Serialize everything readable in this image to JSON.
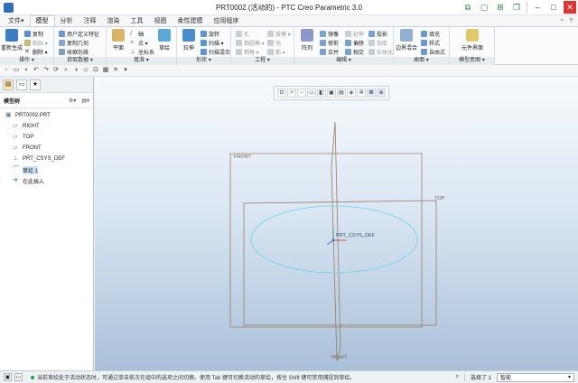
{
  "window": {
    "title": "PRT0002 (活动的) - PTC Creo Parametric 3.0",
    "accent": "#2f6fb5"
  },
  "tabs": [
    {
      "label": "文件",
      "suffix": "▾"
    },
    {
      "label": "模型",
      "active": true
    },
    {
      "label": "分析"
    },
    {
      "label": "注释"
    },
    {
      "label": "渲染"
    },
    {
      "label": "工具"
    },
    {
      "label": "视图"
    },
    {
      "label": "柔性建模"
    },
    {
      "label": "应用程序"
    }
  ],
  "ribbon": {
    "operations": {
      "label": "操作 ▾",
      "regenerate": "重新生成",
      "copy": "复制",
      "paste": "粘贴 ▾",
      "delete": "删除 ▾"
    },
    "get_data": {
      "label": "获取数据 ▾",
      "udf": "用户定义特征",
      "copy_geom": "复制几何",
      "shrinkwrap": "收缩包络"
    },
    "datum": {
      "label": "基准 ▾",
      "plane": "平面",
      "axis": "轴",
      "point": "点 ▾",
      "csys": "坐标系",
      "sketch": "草绘"
    },
    "shapes": {
      "label": "形状 ▾",
      "extrude": "拉伸",
      "revolve": "旋转",
      "sweep": "扫描 ▾",
      "swept_blend": "扫描混合"
    },
    "engineering": {
      "label": "工程 ▾",
      "hole": "孔",
      "round": "倒圆角 ▾",
      "chamfer": "倒角 ▾",
      "draft": "拔模 ▾",
      "shell": "壳",
      "rib": "筋 ▾"
    },
    "editing": {
      "label": "编辑 ▾",
      "pattern": "阵列",
      "mirror": "镜像",
      "trim": "修剪",
      "merge": "合并",
      "extend": "延伸",
      "offset": "偏移",
      "intersect": "相交",
      "project": "投影",
      "thicken": "加厚",
      "solidify": "实体化"
    },
    "surfaces": {
      "label": "曲面 ▾",
      "boundary": "边界混合",
      "fill": "填充",
      "style": "样式",
      "freeform": "自由式"
    },
    "model_intent": {
      "label": "模型意图 ▾",
      "component_interface": "元件界面"
    }
  },
  "panel": {
    "header": "模型树",
    "tree_icon": "tree-icon",
    "root": "PRT0002.PRT",
    "items": [
      {
        "label": "RIGHT",
        "icon": "datum-plane-icon"
      },
      {
        "label": "TOP",
        "icon": "datum-plane-icon"
      },
      {
        "label": "FRONT",
        "icon": "datum-plane-icon"
      },
      {
        "label": "PRT_CSYS_DEF",
        "icon": "csys-icon"
      },
      {
        "label": "草绘 1",
        "icon": "sketch-icon",
        "selected": true
      },
      {
        "label": "在此插入",
        "icon": "insert-here-icon"
      }
    ]
  },
  "scene": {
    "front": "FRONT",
    "top": "TOP",
    "right": "RIGHT",
    "csys": "PRT_CSYS_DEF",
    "plane_color": "#9a7b62",
    "sketch_color": "#62d4ee"
  },
  "status": {
    "message": "当前草绘处于活动状态时，可通过单击依次在组中的选项之间切换。使用 Tab 键可切换活动的草绘，按住 Shift 键可禁用捕捉到草绘。",
    "selection": "选择了 1",
    "filter": "智能"
  }
}
